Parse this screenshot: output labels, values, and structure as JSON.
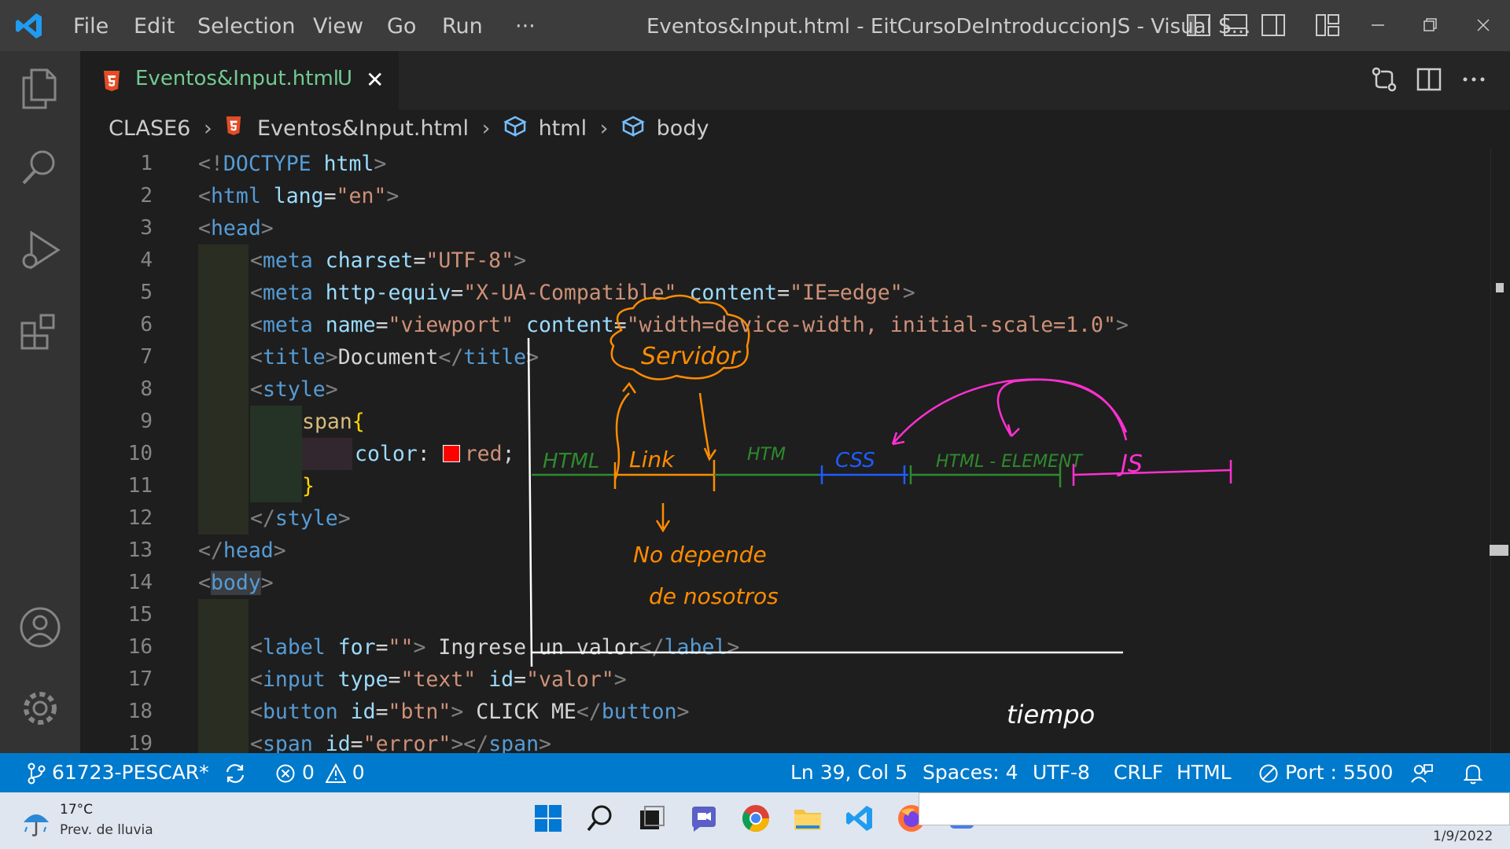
{
  "titlebar": {
    "menu": [
      "File",
      "Edit",
      "Selection",
      "View",
      "Go",
      "Run",
      "···"
    ],
    "window_title": "Eventos&Input.html - EitCursoDeIntroduccionJS - Visual S...",
    "controls": [
      "layout-left-icon",
      "layout-panel-icon",
      "layout-right-icon",
      "customize-layout-icon",
      "minimize-icon",
      "restore-icon",
      "close-icon"
    ]
  },
  "activitybar": {
    "items": [
      "explorer-icon",
      "search-icon",
      "run-debug-icon",
      "extensions-icon"
    ],
    "bottom": [
      "accounts-icon",
      "manage-gear-icon"
    ]
  },
  "tab": {
    "label": "Eventos&Input.html",
    "status": "U",
    "close": "✕",
    "actions": [
      "source-control-compare-icon",
      "split-editor-icon",
      "more-actions-icon"
    ]
  },
  "breadcrumb": {
    "folder": "CLASE6",
    "file": "Eventos&Input.html",
    "html": "html",
    "body": "body"
  },
  "editor": {
    "line_numbers": [
      "1",
      "2",
      "3",
      "4",
      "5",
      "6",
      "7",
      "8",
      "9",
      "10",
      "11",
      "12",
      "13",
      "14",
      "15",
      "16",
      "17",
      "18",
      "19"
    ],
    "l1": {
      "open": "<!",
      "doctype": "DOCTYPE",
      "html": " html",
      "close": ">"
    },
    "l2": {
      "open": "<",
      "tag": "html",
      "attr": " lang",
      "eq": "=",
      "val": "\"en\"",
      "close": ">"
    },
    "l3": {
      "open": "<",
      "tag": "head",
      "close": ">"
    },
    "l4": {
      "open": "<",
      "tag": "meta",
      "attr": " charset",
      "eq": "=",
      "val": "\"UTF-8\"",
      "close": ">"
    },
    "l5": {
      "open": "<",
      "tag": "meta",
      "attr1": " http-equiv",
      "eq1": "=",
      "val1": "\"X-UA-Compatible\"",
      "attr2": " content",
      "eq2": "=",
      "val2": "\"IE=edge\"",
      "close": ">"
    },
    "l6": {
      "open": "<",
      "tag": "meta",
      "attr1": " name",
      "eq1": "=",
      "val1": "\"viewport\"",
      "attr2": " content",
      "eq2": "=",
      "val2": "\"width=device-width, initial-scale=1.0\"",
      "close": ">"
    },
    "l7": {
      "open": "<",
      "tag": "title",
      "gt": ">",
      "text": "Document",
      "close_open": "</",
      "close_tag": "title",
      "close": ">"
    },
    "l8": {
      "open": "<",
      "tag": "style",
      "close": ">"
    },
    "l9": {
      "selector": "span",
      "brace": "{"
    },
    "l10": {
      "prop": "color",
      "colon": ": ",
      "value": "red",
      "semi": ";"
    },
    "l11": {
      "brace": "}"
    },
    "l12": {
      "open": "</",
      "tag": "style",
      "close": ">"
    },
    "l13": {
      "open": "</",
      "tag": "head",
      "close": ">"
    },
    "l14": {
      "open": "<",
      "tag": "body",
      "close": ">"
    },
    "l16": {
      "open": "<",
      "tag": "label",
      "attr": " for",
      "eq": "=",
      "val": "\"\"",
      "gt": ">",
      "text": " Ingrese un valor",
      "close_open": "</",
      "close_tag": "label",
      "close": ">"
    },
    "l17": {
      "open": "<",
      "tag": "input",
      "attr1": " type",
      "eq1": "=",
      "val1": "\"text\"",
      "attr2": " id",
      "eq2": "=",
      "val2": "\"valor\"",
      "close": ">"
    },
    "l18": {
      "open": "<",
      "tag": "button",
      "attr": " id",
      "eq": "=",
      "val": "\"btn\"",
      "gt": ">",
      "text": " CLICK ME",
      "close_open": "</",
      "close_tag": "button",
      "close": ">"
    },
    "l19": {
      "open": "<",
      "tag": "span",
      "attr": " id",
      "eq": "=",
      "val": "\"error\"",
      "gt": ">",
      "close_open": "</",
      "close_tag": "span",
      "close": ">"
    }
  },
  "annotations": {
    "servidor": "Servidor",
    "html": "HTML",
    "link": "Link",
    "htm": "HTM",
    "css": "CSS",
    "html_elem": "HTML - ELEMENT",
    "js": "JS",
    "no_depende": "No depende",
    "de_nosotros": "de nosotros",
    "tiempo": "tiempo",
    "colors": {
      "orange": "#ff8c00",
      "green": "#2e8b2e",
      "blue": "#1e5cff",
      "magenta": "#ff30d0",
      "white": "#ffffff"
    }
  },
  "statusbar": {
    "branch": "61723-PESCAR*",
    "sync_icon": "sync-icon",
    "errors": "0",
    "warnings": "0",
    "position": "Ln 39, Col 5",
    "spaces": "Spaces: 4",
    "encoding": "UTF-8",
    "eol": "CRLF",
    "language": "HTML",
    "port": "Port : 5500",
    "accent": "#007acc"
  },
  "taskbar": {
    "temperature": "17°C",
    "weather": "Prev. de lluvia",
    "date": "1/9/2022",
    "apps": [
      "windows-start-icon",
      "search-icon",
      "task-view-icon",
      "chat-icon",
      "chrome-icon",
      "file-explorer-icon",
      "vscode-icon",
      "firefox-icon",
      "app-icon"
    ]
  }
}
